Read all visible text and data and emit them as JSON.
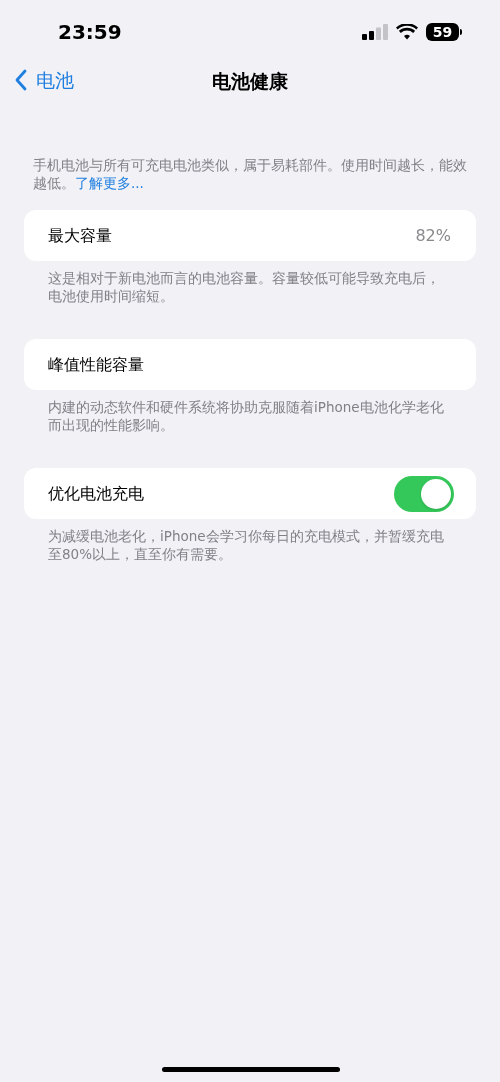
{
  "status_bar": {
    "time": "23:59",
    "battery": "59"
  },
  "nav": {
    "back": "电池",
    "title": "电池健康"
  },
  "intro": {
    "text": "手机电池与所有可充电电池类似，属于易耗部件。使用时间越长，能效越低。",
    "link": "了解更多..."
  },
  "sections": [
    {
      "kind": "value",
      "label": "最大容量",
      "value": "82%",
      "footer": "这是相对于新电池而言的电池容量。容量较低可能导致充电后，电池使用时间缩短。"
    },
    {
      "kind": "plain",
      "label": "峰值性能容量",
      "footer": "内建的动态软件和硬件系统将协助克服随着iPhone电池化学老化而出现的性能影响。"
    },
    {
      "kind": "toggle",
      "label": "优化电池充电",
      "on": true,
      "footer": "为减缓电池老化，iPhone会学习你每日的充电模式，并暂缓充电至80%以上，直至你有需要。"
    }
  ]
}
